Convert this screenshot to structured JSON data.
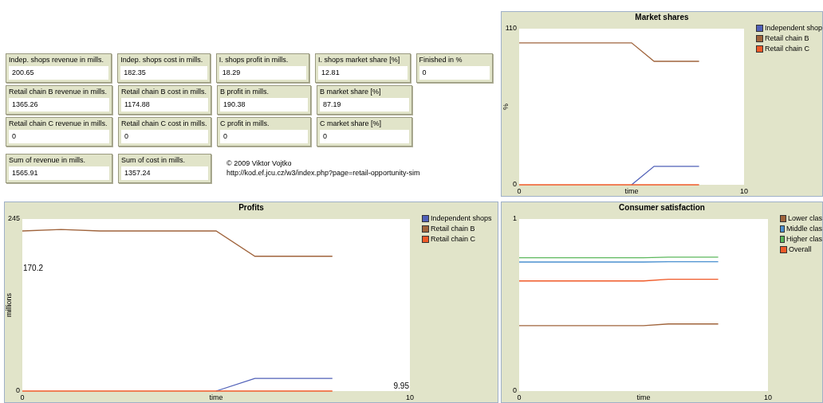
{
  "monitor_rows": [
    [
      {
        "label": "Indep. shops revenue in mills.",
        "value": "200.65"
      },
      {
        "label": "Indep. shops cost in mills.",
        "value": "182.35"
      },
      {
        "label": "I. shops profit in mills.",
        "value": "18.29"
      },
      {
        "label": "I. shops market share [%]",
        "value": "12.81"
      },
      {
        "label": "Finished in %",
        "value": "0"
      }
    ],
    [
      {
        "label": "Retail chain B revenue in mills.",
        "value": "1365.26"
      },
      {
        "label": "Retail chain B cost in mills.",
        "value": "1174.88"
      },
      {
        "label": "B profit in mills.",
        "value": "190.38"
      },
      {
        "label": "B market share [%]",
        "value": "87.19"
      }
    ],
    [
      {
        "label": "Retail chain C revenue in mills.",
        "value": "0"
      },
      {
        "label": "Retail chain C cost in mills.",
        "value": "0"
      },
      {
        "label": "C profit in mills.",
        "value": "0"
      },
      {
        "label": "C market share [%]",
        "value": "0"
      }
    ],
    [
      {
        "label": "Sum of revenue in mills.",
        "value": "1565.91"
      },
      {
        "label": "Sum of cost in mills.",
        "value": "1357.24"
      }
    ]
  ],
  "credits": {
    "author": "© 2009 Viktor Vojtko",
    "url": "http://kod.ef.jcu.cz/w3/index.php?page=retail-opportunity-sim"
  },
  "market_shares": {
    "chart_data": {
      "type": "line",
      "title": "Market shares",
      "xlabel": "time",
      "ylabel": "%",
      "x": [
        0,
        1,
        2,
        3,
        4,
        5,
        6,
        7,
        8
      ],
      "xlim": [
        0,
        10
      ],
      "ylim": [
        0,
        110
      ],
      "xticks": [
        0,
        10
      ],
      "yticks": [
        0,
        110
      ],
      "series": [
        {
          "name": "Independent shop",
          "color": "#5060b8",
          "values": [
            null,
            null,
            null,
            null,
            null,
            0,
            13,
            13,
            13
          ]
        },
        {
          "name": "Retail chain B",
          "color": "#a0643c",
          "values": [
            100,
            100,
            100,
            100,
            100,
            100,
            87,
            87,
            87
          ]
        },
        {
          "name": "Retail chain C",
          "color": "#f05a28",
          "values": [
            0,
            0,
            0,
            0,
            0,
            0,
            0,
            0,
            0
          ]
        }
      ]
    }
  },
  "profits": {
    "chart_data": {
      "type": "line",
      "title": "Profits",
      "xlabel": "time",
      "ylabel": "millions",
      "x": [
        0,
        1,
        2,
        3,
        4,
        5,
        6,
        7,
        8
      ],
      "xlim": [
        0,
        10
      ],
      "ylim": [
        0,
        245
      ],
      "xticks": [
        0,
        10
      ],
      "yticks": [
        0,
        245
      ],
      "annotations": [
        "170.2",
        "9.95"
      ],
      "series": [
        {
          "name": "Independent shops",
          "color": "#5060b8",
          "values": [
            null,
            null,
            null,
            null,
            null,
            0,
            18,
            18,
            18
          ]
        },
        {
          "name": "Retail chain B",
          "color": "#a0643c",
          "values": [
            228,
            230,
            228,
            228,
            228,
            228,
            192,
            192,
            192
          ]
        },
        {
          "name": "Retail chain C",
          "color": "#f05a28",
          "values": [
            0,
            0,
            0,
            0,
            0,
            0,
            0,
            0,
            0
          ]
        }
      ]
    }
  },
  "consumer_satisfaction": {
    "chart_data": {
      "type": "line",
      "title": "Consumer satisfaction",
      "xlabel": "time",
      "x": [
        0,
        1,
        2,
        3,
        4,
        5,
        6,
        7,
        8
      ],
      "xlim": [
        0,
        10
      ],
      "ylim": [
        0,
        1
      ],
      "xticks": [
        0,
        10
      ],
      "yticks": [
        0,
        1
      ],
      "series": [
        {
          "name": "Lower clas",
          "color": "#a0643c",
          "values": [
            0.38,
            0.38,
            0.38,
            0.38,
            0.38,
            0.38,
            0.39,
            0.39,
            0.39
          ]
        },
        {
          "name": "Middle clas",
          "color": "#4a90d0",
          "values": [
            0.75,
            0.75,
            0.75,
            0.75,
            0.75,
            0.75,
            0.752,
            0.752,
            0.752
          ]
        },
        {
          "name": "Higher clas",
          "color": "#5cb85c",
          "values": [
            0.775,
            0.775,
            0.775,
            0.775,
            0.775,
            0.775,
            0.778,
            0.778,
            0.778
          ]
        },
        {
          "name": "Overall",
          "color": "#f05a28",
          "values": [
            0.64,
            0.64,
            0.64,
            0.64,
            0.64,
            0.64,
            0.65,
            0.65,
            0.65
          ]
        }
      ]
    }
  }
}
